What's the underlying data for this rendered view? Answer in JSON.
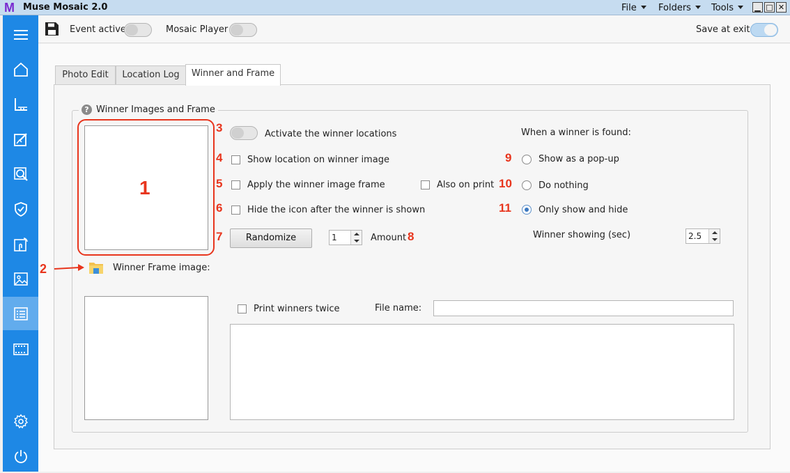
{
  "app": {
    "logo": "M",
    "title": "Muse Mosaic 2.0"
  },
  "menu": {
    "file": "File",
    "folders": "Folders",
    "tools": "Tools"
  },
  "window_controls": {
    "minimize": "▁",
    "maximize": "□",
    "close": "✕"
  },
  "sidebar": {
    "items": [
      {
        "icon": "menu-icon"
      },
      {
        "icon": "home-icon"
      },
      {
        "icon": "ruler-icon"
      },
      {
        "icon": "edit-photo-icon"
      },
      {
        "icon": "search-icon"
      },
      {
        "icon": "shield-icon"
      },
      {
        "icon": "touch-screen-icon"
      },
      {
        "icon": "image-icon"
      },
      {
        "icon": "checklist-icon",
        "active": true
      },
      {
        "icon": "film-icon"
      },
      {
        "icon": "gear-icon"
      },
      {
        "icon": "power-icon"
      }
    ]
  },
  "toolbar": {
    "event_active_label": "Event active",
    "event_active_on": false,
    "mosaic_player_label": "Mosaic Player",
    "mosaic_player_on": false,
    "save_at_exit_label": "Save at exit",
    "save_at_exit_on": true
  },
  "tabs": [
    "Photo Edit",
    "Location Log",
    "Winner and Frame"
  ],
  "active_tab": "Winner and Frame",
  "group": {
    "title": "Winner Images and Frame",
    "help_icon": "?",
    "activate_label": "Activate the winner locations",
    "activate_on": false,
    "show_location_label": "Show location on winner image",
    "apply_frame_label": "Apply the winner image frame",
    "also_on_print_label": "Also on print",
    "hide_icon_label": "Hide the icon after the winner is shown",
    "randomize_label": "Randomize",
    "amount_value": "1",
    "amount_label": "Amount",
    "when_found_label": "When a winner is found:",
    "radio_popup_label": "Show as a pop-up",
    "radio_nothing_label": "Do nothing",
    "radio_showhide_label": "Only show and hide",
    "radio_selected": "Only show and hide",
    "winner_showing_label": "Winner showing (sec)",
    "winner_showing_value": "2.5",
    "frame_image_label": "Winner Frame image:",
    "print_twice_label": "Print winners twice",
    "file_name_label": "File name:",
    "file_name_value": ""
  },
  "annotations": {
    "n1": "1",
    "n2": "2",
    "n3": "3",
    "n4": "4",
    "n5": "5",
    "n6": "6",
    "n7": "7",
    "n8": "8",
    "n9": "9",
    "n10": "10",
    "n11": "11"
  },
  "colors": {
    "sidebar": "#1e88e5",
    "sidebar_active": "#62aced",
    "annotation": "#e8351d",
    "title_bar": "#c6dcf0"
  }
}
